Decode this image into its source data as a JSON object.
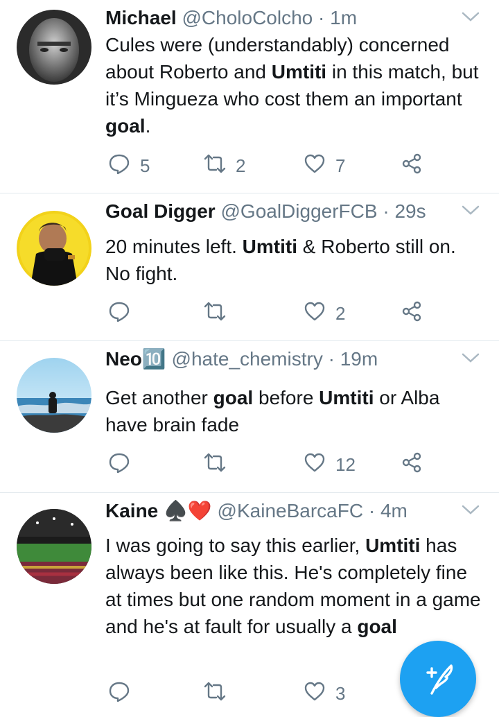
{
  "tweets": [
    {
      "name": "Michael",
      "handle": "@CholoColcho",
      "time": "1m",
      "text_html": "Cules were (understandably) concerned about Roberto and <b>Umtiti</b> in this match, but it’s Mingueza who cost them an important <b>goal</b>.",
      "replies": "5",
      "retweets": "2",
      "likes": "7"
    },
    {
      "name": "Goal Digger",
      "handle": "@GoalDiggerFCB",
      "time": "29s",
      "text_html": "20 minutes left. <b>Umtiti</b> &amp; Roberto still on. No fight.",
      "replies": "",
      "retweets": "",
      "likes": "2"
    },
    {
      "name": "Neo🔟",
      "handle": "@hate_chemistry",
      "time": "19m",
      "text_html": "Get another <b>goal</b> before <b>Umtiti</b> or Alba have brain fade",
      "replies": "",
      "retweets": "",
      "likes": "12"
    },
    {
      "name": "Kaine ♠️❤️",
      "handle": "@KaineBarcaFC",
      "time": "4m",
      "text_html": "I was going to say this earlier, <b>Umtiti</b> has always been like this. He's completely fine at times but one random moment in a game and he's at fault for usually a <b>goal</b>",
      "replies": "",
      "retweets": "",
      "likes": "3"
    }
  ],
  "dot": "·",
  "colors": {
    "accent": "#1da1f2",
    "muted": "#657786",
    "divider": "#e1e8ed"
  },
  "icons": [
    "chevron-down-icon",
    "reply-icon",
    "retweet-icon",
    "like-icon",
    "share-icon",
    "compose-tweet-icon"
  ]
}
